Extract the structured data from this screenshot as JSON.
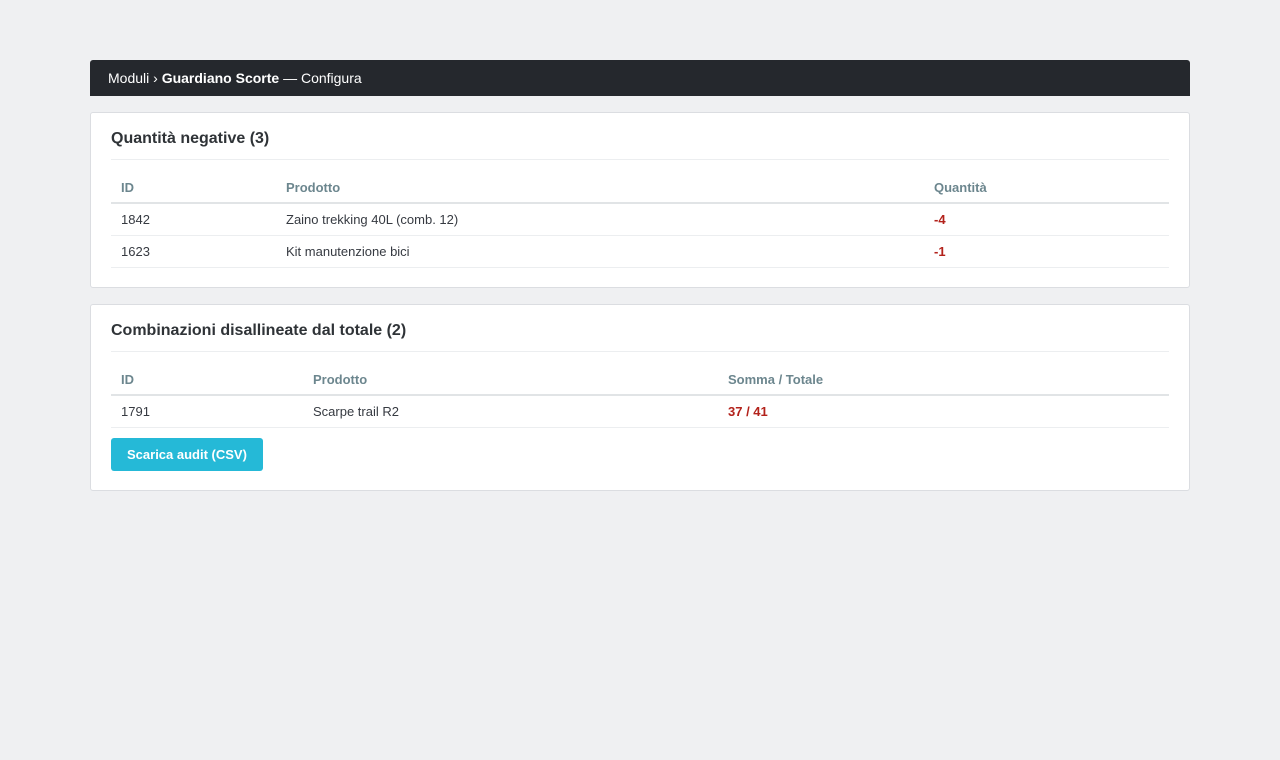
{
  "breadcrumb": {
    "root": "Moduli",
    "separator": "›",
    "module": "Guardiano Scorte",
    "suffix": "— Configura"
  },
  "negative": {
    "title": "Quantità negative (3)",
    "columns": [
      "ID",
      "Prodotto",
      "Quantità"
    ],
    "rows": [
      {
        "id": "1842",
        "product": "Zaino trekking 40L (comb. 12)",
        "qty": "-4"
      },
      {
        "id": "1623",
        "product": "Kit manutenzione bici",
        "qty": "-1"
      }
    ]
  },
  "mismatch": {
    "title": "Combinazioni disallineate dal totale (2)",
    "columns": [
      "ID",
      "Prodotto",
      "Somma / Totale"
    ],
    "rows": [
      {
        "id": "1791",
        "product": "Scarpe trail R2",
        "ratio": "37 / 41"
      }
    ]
  },
  "actions": {
    "download_label": "Scarica audit (CSV)"
  },
  "colors": {
    "topbar": "#25282d",
    "accent": "#25b9d7",
    "danger": "#b3221b",
    "header_text": "#6c868e"
  }
}
